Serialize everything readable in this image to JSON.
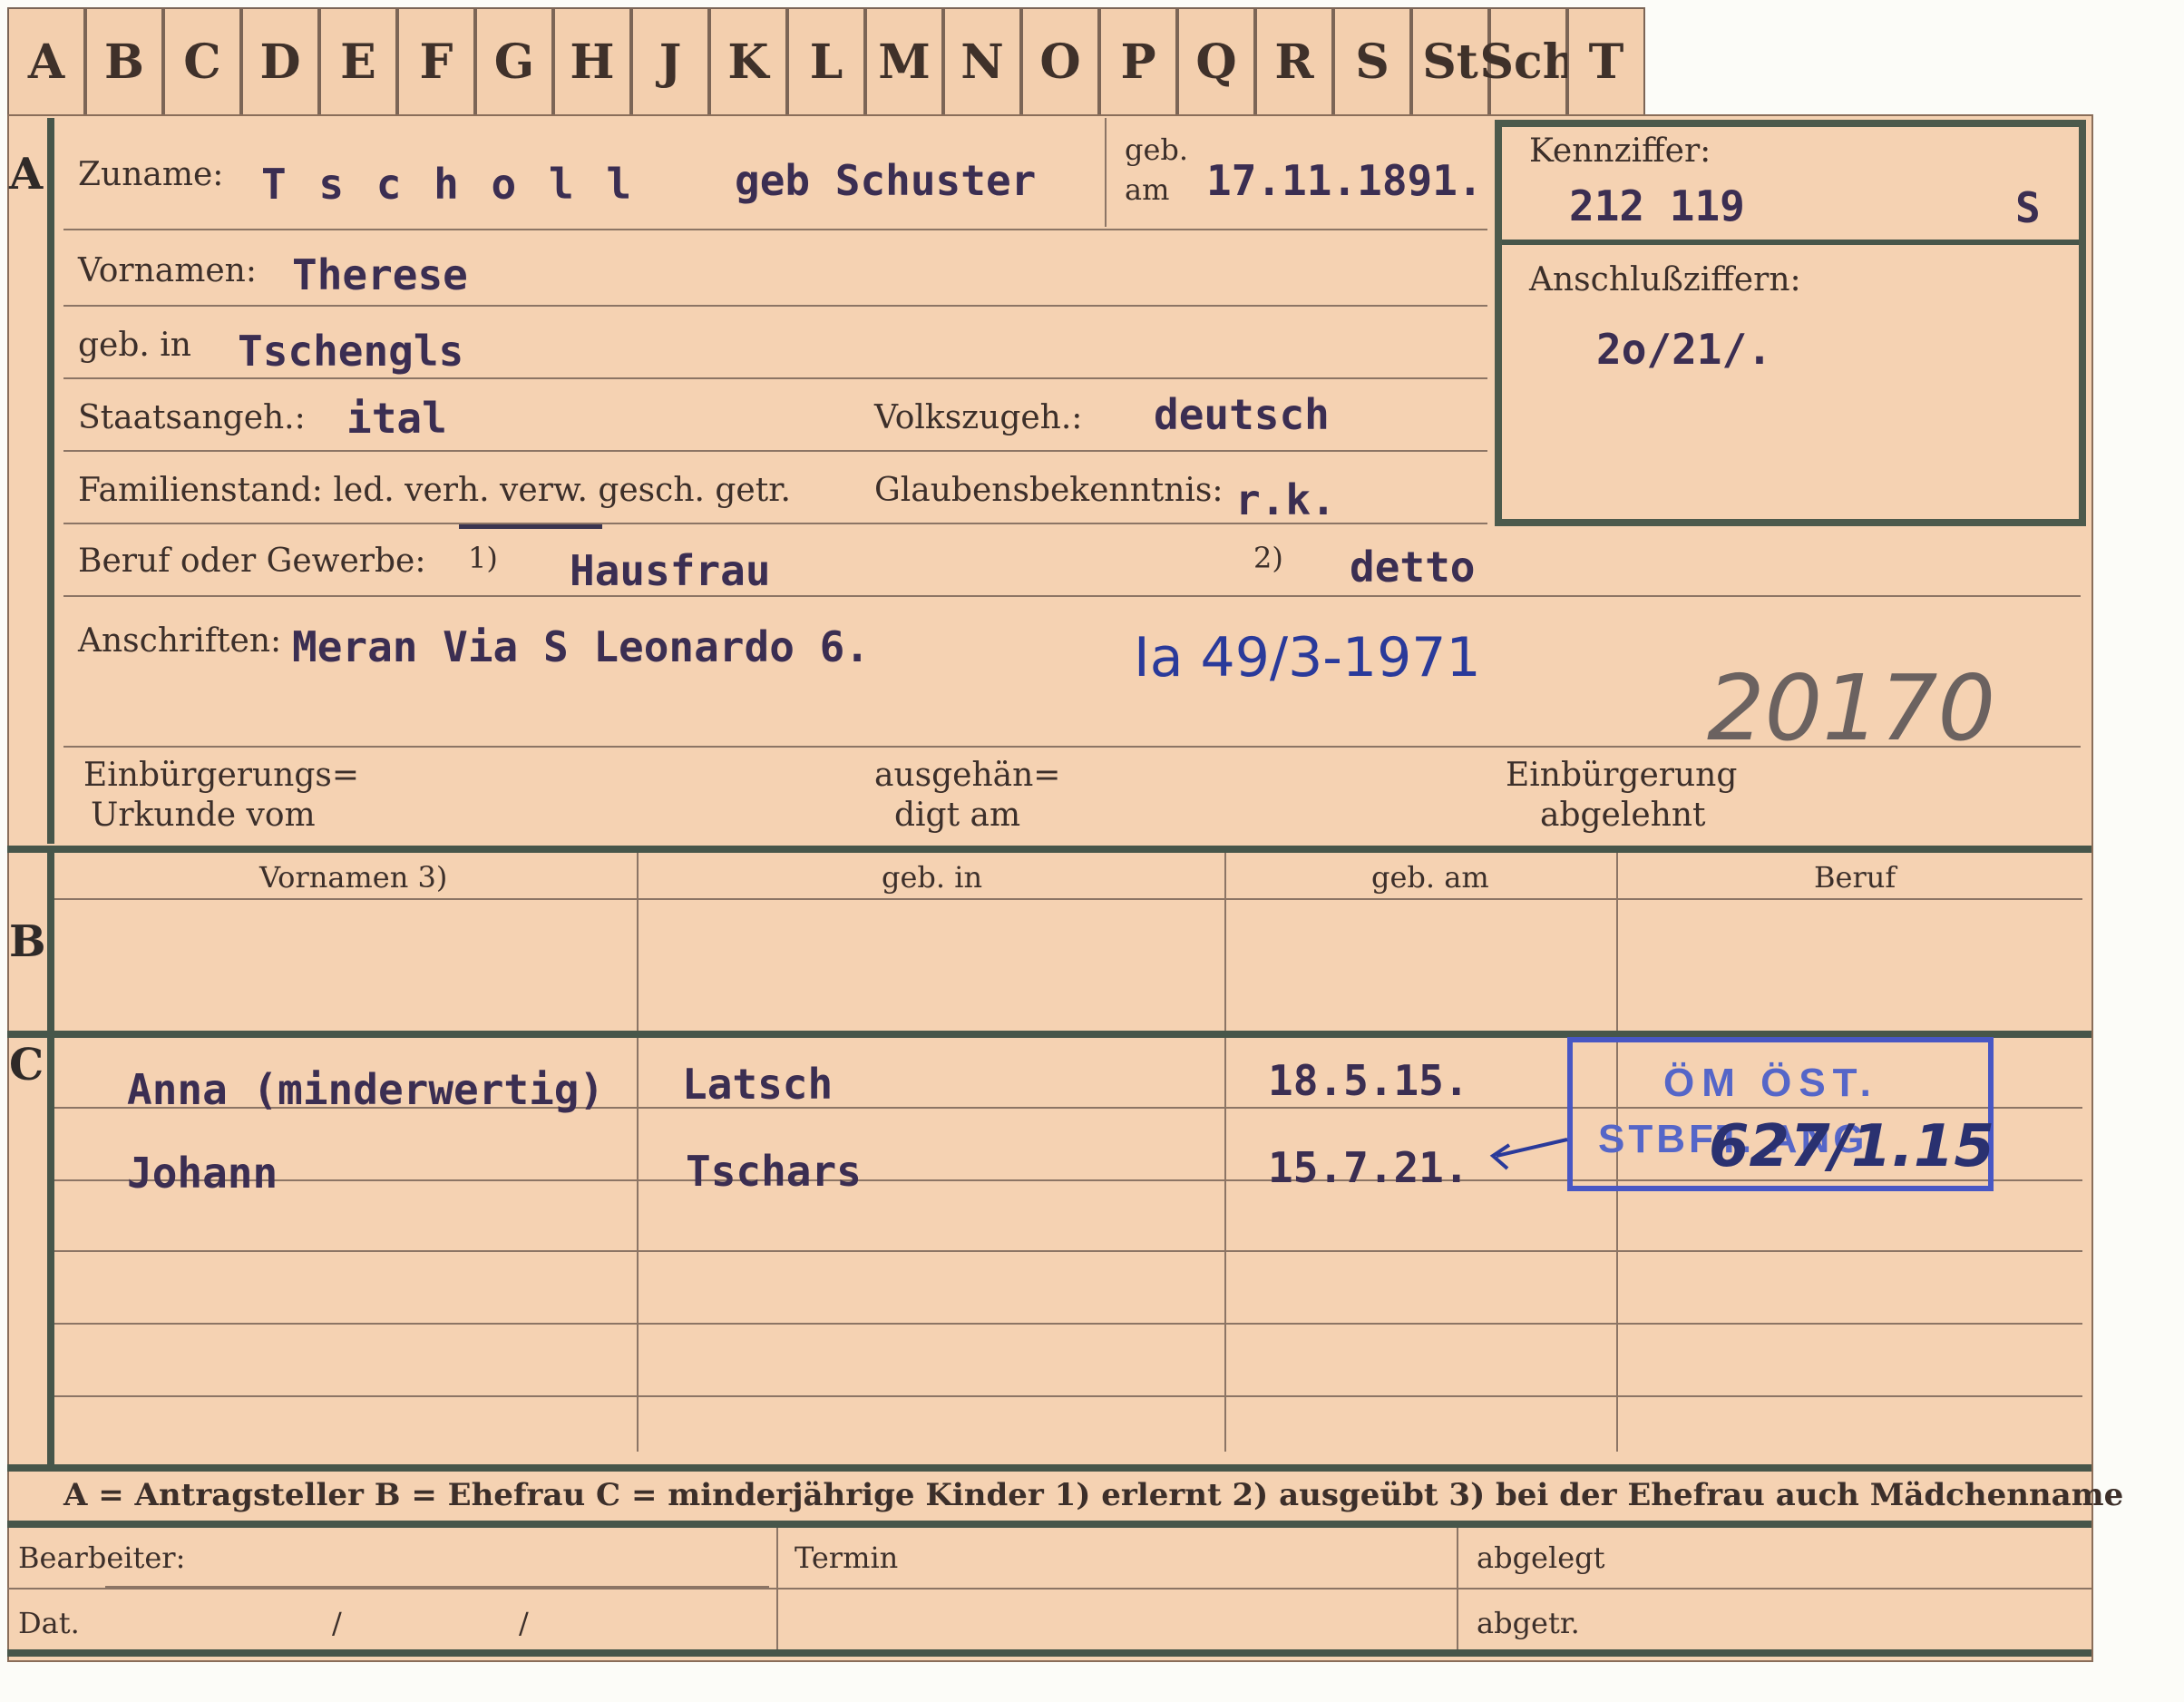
{
  "tabs": [
    "A",
    "B",
    "C",
    "D",
    "E",
    "F",
    "G",
    "H",
    "J",
    "K",
    "L",
    "M",
    "N",
    "O",
    "P",
    "Q",
    "R",
    "S",
    "St",
    "Sch",
    "T"
  ],
  "section_letters": {
    "a": "A",
    "b": "B",
    "c": "C"
  },
  "labels": {
    "zuname": "Zuname:",
    "geb_am_1": "geb.",
    "geb_am_2": "am",
    "kennziffer": "Kennziffer:",
    "anschlussziffern": "Anschlußziffern:",
    "vornamen": "Vornamen:",
    "geb_in": "geb. in",
    "staatsangeh": "Staatsangeh.:",
    "volkszugeh": "Volkszugeh.:",
    "familienstand": "Familienstand: led. verh. verw. gesch. getr.",
    "glaubensbekenntnis": "Glaubensbekenntnis:",
    "beruf": "Beruf oder Gewerbe:",
    "beruf_note1": "1)",
    "beruf_note2": "2)",
    "anschriften": "Anschriften:",
    "einbuergerung_1": "Einbürgerungs=",
    "einbuergerung_2": "Urkunde vom",
    "ausgehaendigt_1": "ausgehän=",
    "ausgehaendigt_2": "digt am",
    "abgelehnt_1": "Einbürgerung",
    "abgelehnt_2": "abgelehnt",
    "col_vornamen": "Vornamen 3)",
    "col_geb_in": "geb. in",
    "col_geb_am": "geb. am",
    "col_beruf": "Beruf",
    "legend": "A = Antragsteller   B = Ehefrau   C = minderjährige Kinder   1) erlernt   2) ausgeübt   3) bei der Ehefrau auch Mädchenname",
    "bearbeiter": "Bearbeiter:",
    "termin": "Termin",
    "abgelegt": "abgelegt",
    "dat": "Dat.",
    "slash": "/",
    "abgetr": "abgetr."
  },
  "values": {
    "zuname": "T s c h o l l",
    "geborene": "geb Schuster",
    "geburtsdatum": "17.11.1891.",
    "kennziffer": "212 119",
    "kennziffer_suffix": "S",
    "anschlussziffern": "2o/21/.",
    "vornamen": "Therese",
    "geburtsort": "Tschengls",
    "staatsangehoerigkeit": "ital",
    "volkszugehoerigkeit": "deutsch",
    "glaubensbekenntnis": "r.k.",
    "beruf_erlernt": "Hausfrau",
    "beruf_ausgeuebt": "detto",
    "anschrift": "Meran Via S Leonardo 6.",
    "handwritten_ref": "Ia 49/3-1971",
    "pencil_number": "20170"
  },
  "children": [
    {
      "vorname": "Anna (minderwertig)",
      "geb_in": "Latsch",
      "geb_am": "18.5.15."
    },
    {
      "vorname": "Johann",
      "geb_in": "Tschars",
      "geb_am": "15.7.21."
    }
  ],
  "stamp": {
    "line1": "ÖM ÖST.",
    "line2": "STBFT. ANG.",
    "handwritten": "627/1.15"
  }
}
